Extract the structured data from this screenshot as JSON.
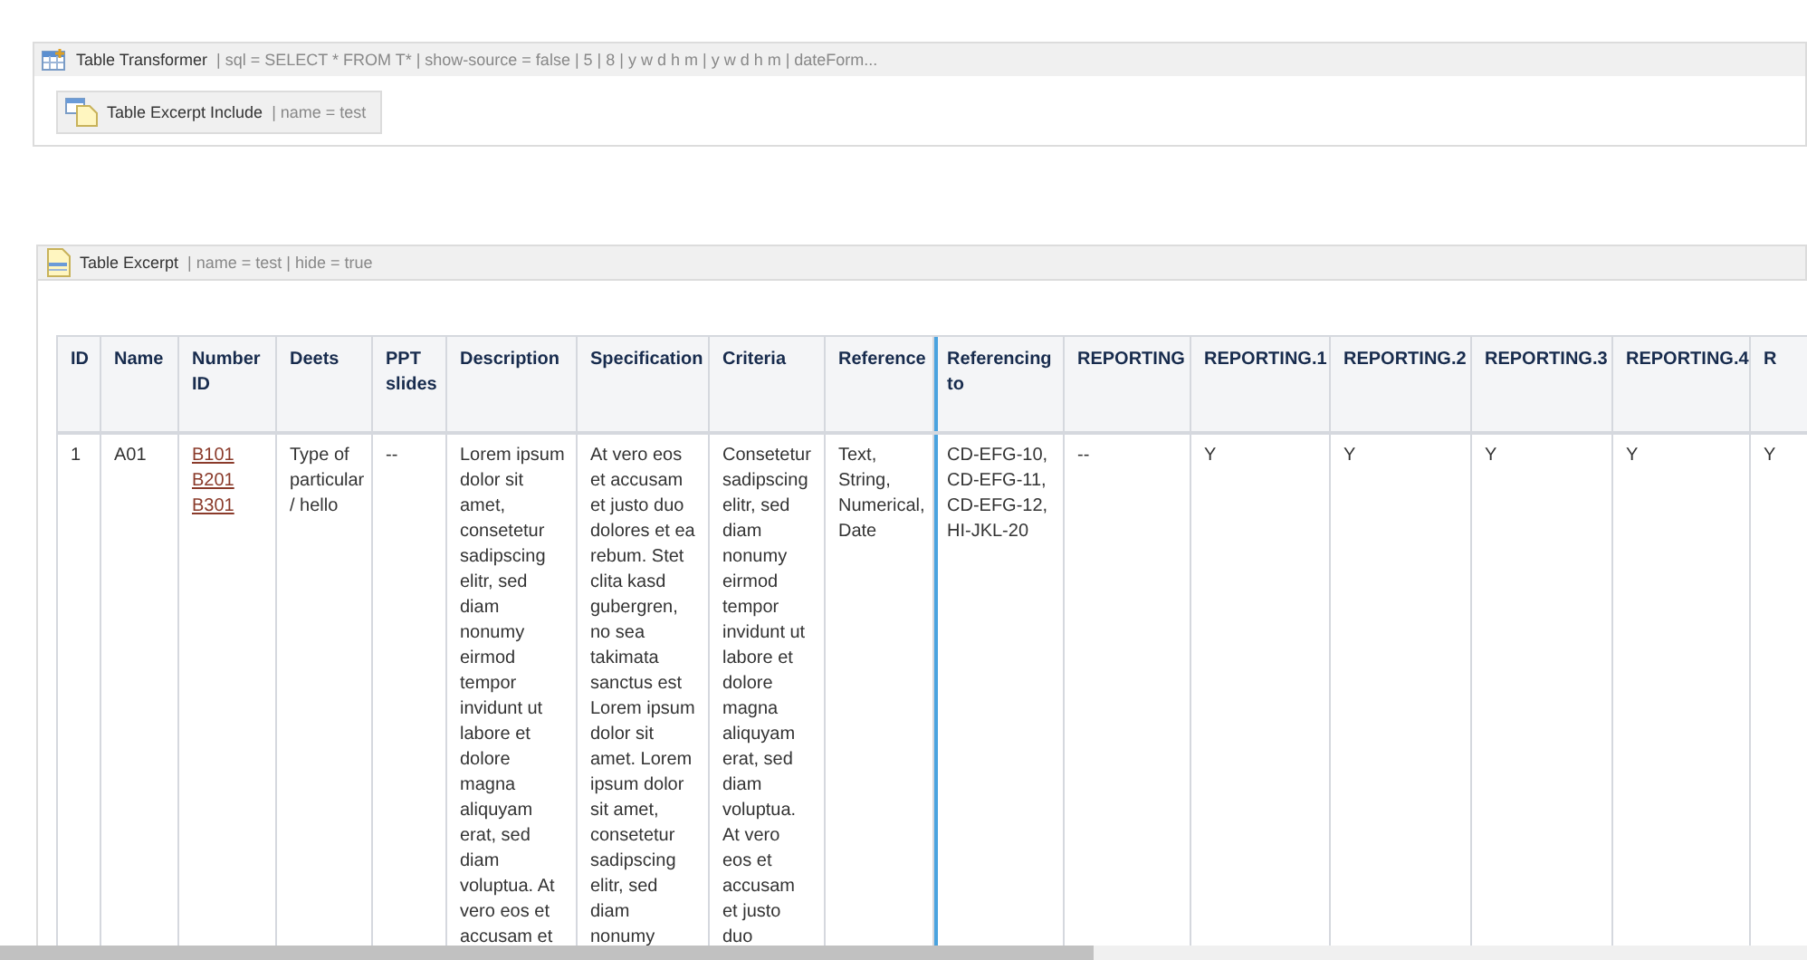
{
  "transformer": {
    "title": "Table Transformer",
    "params": "| sql = SELECT * FROM T* | show-source = false | 5 | 8 | y w d h m | y w d h m | dateForm..."
  },
  "include": {
    "title": "Table Excerpt Include",
    "params": "| name = test"
  },
  "excerpt": {
    "title": "Table Excerpt",
    "params": "| name = test | hide = true"
  },
  "table": {
    "columns": [
      {
        "label": "ID",
        "highlighted": false
      },
      {
        "label": "Name",
        "highlighted": false
      },
      {
        "label": "Number ID",
        "highlighted": false
      },
      {
        "label": "Deets",
        "highlighted": false
      },
      {
        "label": "PPT slides",
        "highlighted": false
      },
      {
        "label": "Description",
        "highlighted": false
      },
      {
        "label": "Specification",
        "highlighted": false
      },
      {
        "label": "Criteria",
        "highlighted": false
      },
      {
        "label": "Reference",
        "highlighted": false
      },
      {
        "label": "Referencing to",
        "highlighted": true
      },
      {
        "label": "REPORTING",
        "highlighted": false
      },
      {
        "label": "REPORTING.1",
        "highlighted": false
      },
      {
        "label": "REPORTING.2",
        "highlighted": false
      },
      {
        "label": "REPORTING.3",
        "highlighted": false
      },
      {
        "label": "REPORTING.4",
        "highlighted": false
      },
      {
        "label": "R",
        "highlighted": false
      }
    ],
    "rows": [
      {
        "cells": [
          {
            "kind": "text",
            "text": "1"
          },
          {
            "kind": "text",
            "text": "A01"
          },
          {
            "kind": "links",
            "links": [
              "B101",
              "B201",
              "B301"
            ]
          },
          {
            "kind": "text",
            "text": "Type of particular / hello"
          },
          {
            "kind": "text",
            "text": "--"
          },
          {
            "kind": "text",
            "text": "Lorem ipsum dolor sit amet, consetetur sadipscing elitr, sed diam nonumy eirmod tempor invidunt ut labore et dolore magna aliquyam erat, sed diam voluptua. At vero eos et accusam et"
          },
          {
            "kind": "text",
            "text": "At vero eos et accusam et justo duo dolores et ea rebum. Stet clita kasd gubergren, no sea takimata sanctus est Lorem ipsum dolor sit amet. Lorem ipsum dolor sit amet, consetetur sadipscing elitr, sed diam nonumy"
          },
          {
            "kind": "text",
            "text": "Consetetur sadipscing elitr, sed diam nonumy eirmod tempor invidunt ut labore et dolore magna aliquyam erat, sed diam voluptua. At vero eos et accusam et justo duo"
          },
          {
            "kind": "text",
            "text": "Text, String, Numerical, Date"
          },
          {
            "kind": "text",
            "text": "CD-EFG-10, CD-EFG-11, CD-EFG-12, HI-JKL-20"
          },
          {
            "kind": "text",
            "text": "--"
          },
          {
            "kind": "text",
            "text": "Y"
          },
          {
            "kind": "text",
            "text": "Y"
          },
          {
            "kind": "text",
            "text": "Y"
          },
          {
            "kind": "text",
            "text": "Y"
          },
          {
            "kind": "text",
            "text": "Y"
          }
        ]
      }
    ]
  }
}
